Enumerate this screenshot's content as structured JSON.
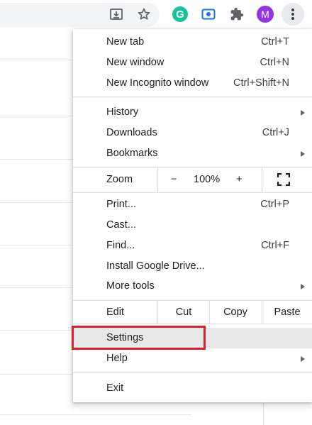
{
  "toolbar": {
    "icons": [
      "install-page-icon",
      "bookmark-star-icon",
      "grammarly-icon",
      "screen-capture-icon",
      "extensions-puzzle-icon",
      "profile-avatar",
      "more-menu-icon"
    ],
    "grammarly_letter": "G",
    "avatar_letter": "M",
    "colors": {
      "grammarly": "#15c39a",
      "avatar": "#9334e6",
      "capture": "#1a73e8"
    }
  },
  "menu": {
    "new_tab": {
      "label": "New tab",
      "shortcut": "Ctrl+T"
    },
    "new_window": {
      "label": "New window",
      "shortcut": "Ctrl+N"
    },
    "new_incognito": {
      "label": "New Incognito window",
      "shortcut": "Ctrl+Shift+N"
    },
    "history": {
      "label": "History"
    },
    "downloads": {
      "label": "Downloads",
      "shortcut": "Ctrl+J"
    },
    "bookmarks": {
      "label": "Bookmarks"
    },
    "zoom": {
      "label": "Zoom",
      "minus": "−",
      "value": "100%",
      "plus": "+"
    },
    "print": {
      "label": "Print...",
      "shortcut": "Ctrl+P"
    },
    "cast": {
      "label": "Cast..."
    },
    "find": {
      "label": "Find...",
      "shortcut": "Ctrl+F"
    },
    "install": {
      "label": "Install Google Drive..."
    },
    "more_tools": {
      "label": "More tools"
    },
    "edit": {
      "label": "Edit",
      "cut": "Cut",
      "copy": "Copy",
      "paste": "Paste"
    },
    "settings": {
      "label": "Settings"
    },
    "help": {
      "label": "Help"
    },
    "exit": {
      "label": "Exit"
    }
  },
  "annotation": {
    "highlight_color": "#e0202a",
    "target": "Settings"
  }
}
